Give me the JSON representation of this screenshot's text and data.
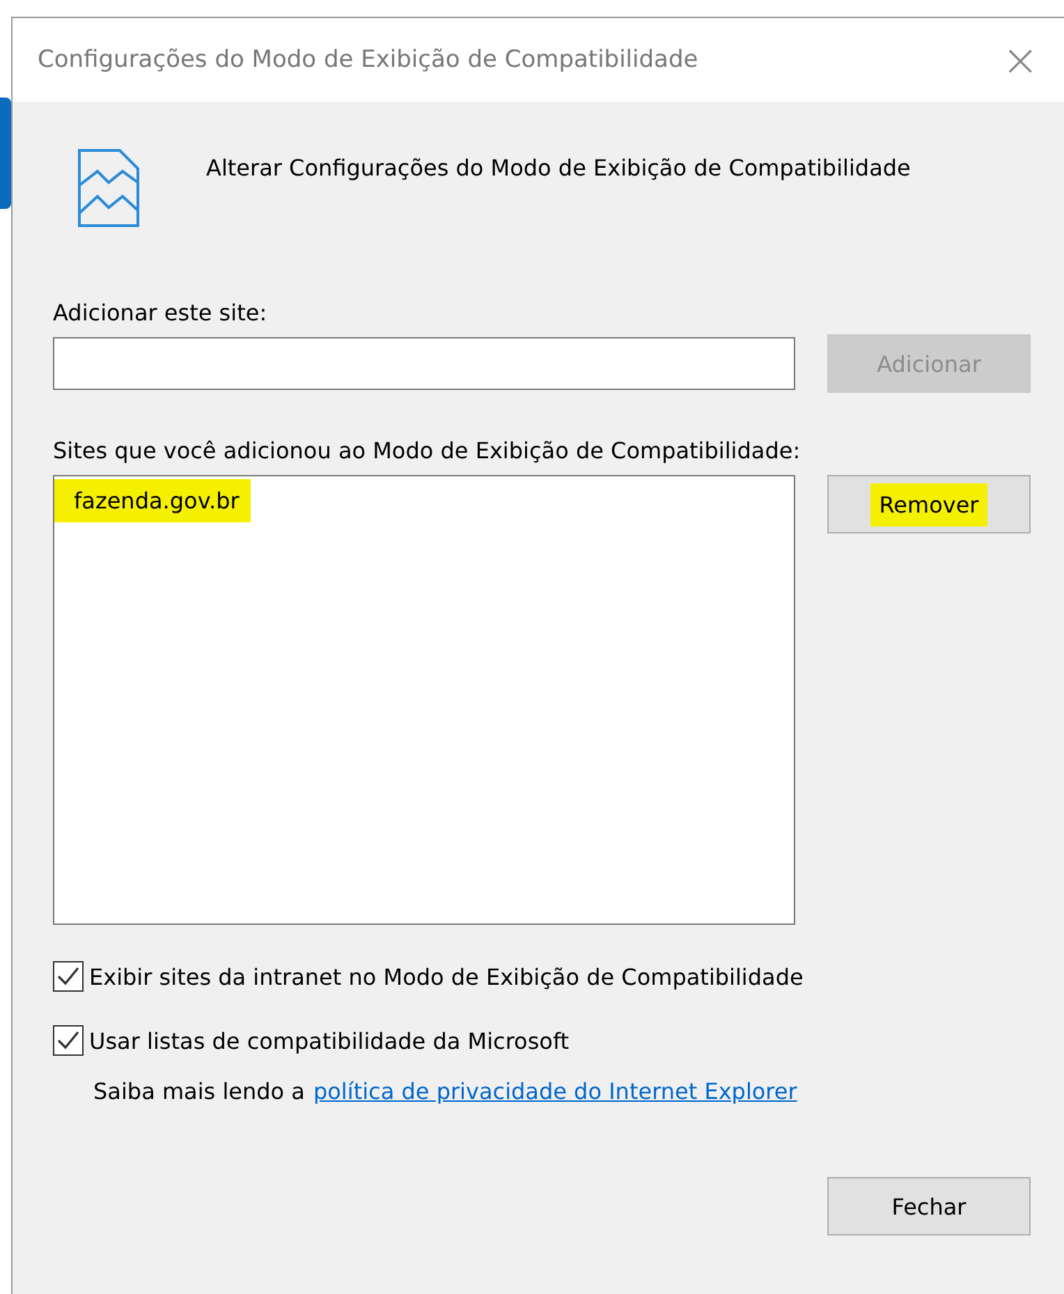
{
  "window": {
    "title": "Configurações do Modo de Exibição de Compatibilidade",
    "close": "×"
  },
  "heading": "Alterar Configurações do Modo de Exibição de Compatibilidade",
  "add_site": {
    "label": "Adicionar este site:",
    "button": {
      "label": "Adicionar",
      "disabled": true
    }
  },
  "sites": {
    "label": "Sites que você adicionou ao Modo de Exibição de Compatibilidade:",
    "items": [
      {
        "text": "fazenda.gov.br",
        "highlighted": true
      }
    ],
    "button": {
      "label": "Remover",
      "highlighted": true
    }
  },
  "options": [
    {
      "label": "Exibir sites da intranet no Modo de Exibição de Compatibilidade",
      "checked": true
    },
    {
      "label": "Usar listas de compatibilidade da Microsoft",
      "checked": true
    }
  ],
  "privacy": {
    "text": "Saiba mais lendo a",
    "link": "política de privacidade do Internet Explorer"
  },
  "buttons": [
    {
      "label": "Fechar"
    }
  ]
}
